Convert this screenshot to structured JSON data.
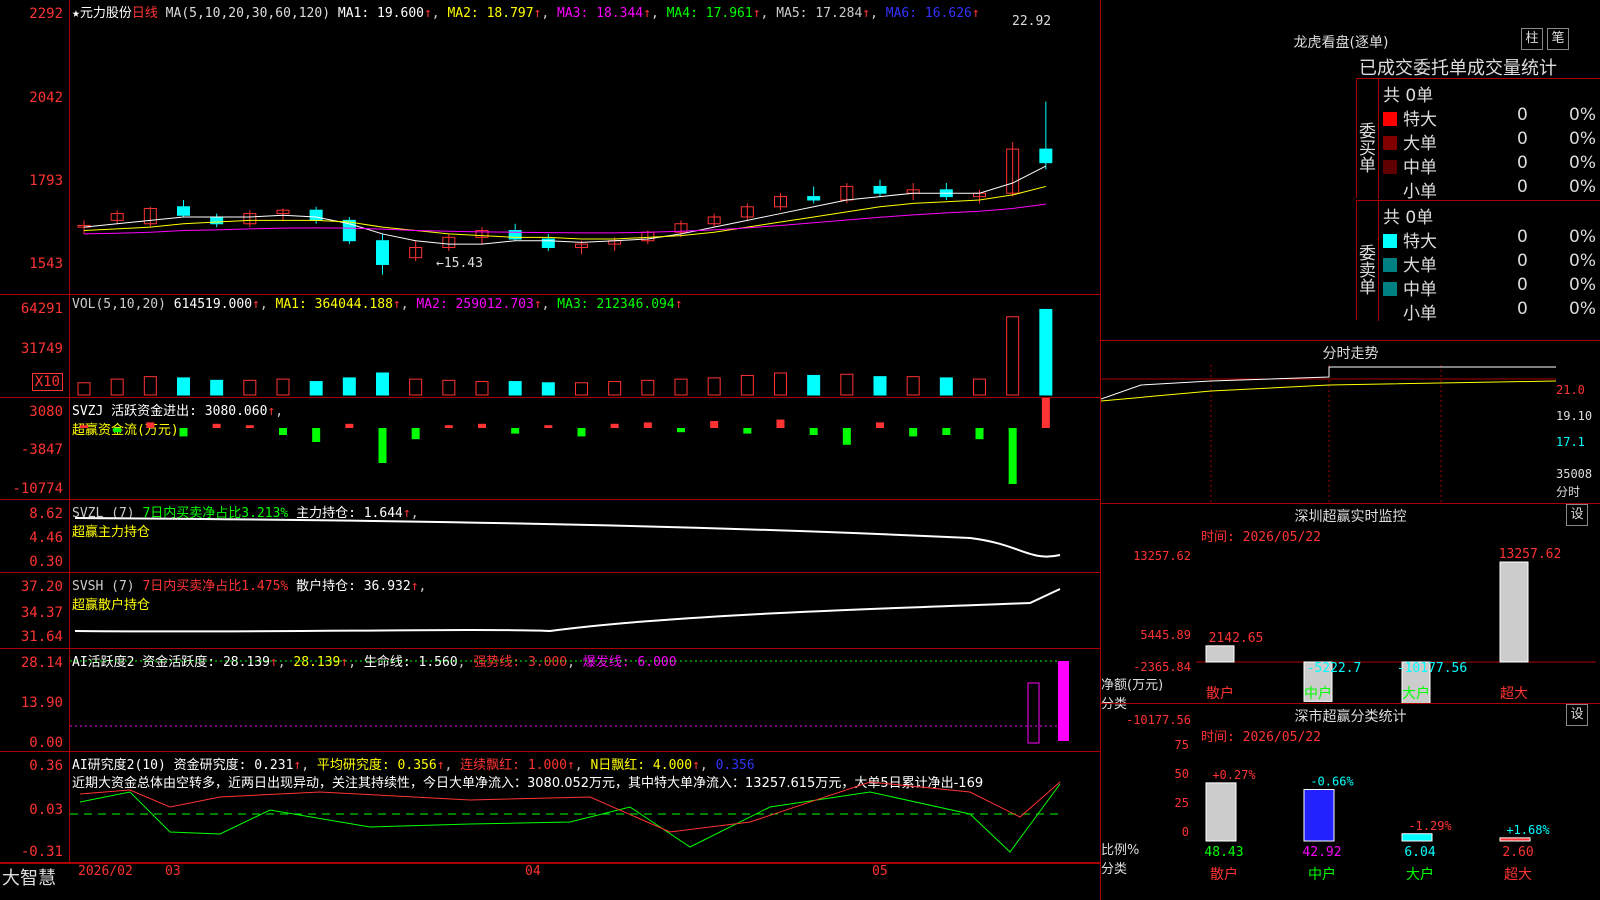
{
  "chart_data": {
    "type": "candlestick",
    "price_ticks": [
      "2292",
      "2042",
      "1793",
      "1543"
    ],
    "last_price": "22.92",
    "low_price": "15.43",
    "candles": [
      [
        16.8,
        17.0,
        16.6,
        16.85
      ],
      [
        17.0,
        17.3,
        16.9,
        17.2
      ],
      [
        16.9,
        17.4,
        16.8,
        17.35
      ],
      [
        17.4,
        17.6,
        17.1,
        17.15
      ],
      [
        17.1,
        17.2,
        16.8,
        16.9
      ],
      [
        16.9,
        17.3,
        16.8,
        17.2
      ],
      [
        17.2,
        17.35,
        17.0,
        17.3
      ],
      [
        17.3,
        17.4,
        16.9,
        17.0
      ],
      [
        17.0,
        17.1,
        16.3,
        16.4
      ],
      [
        16.4,
        16.6,
        15.4,
        15.7
      ],
      [
        15.9,
        16.4,
        15.8,
        16.2
      ],
      [
        16.2,
        16.6,
        16.1,
        16.5
      ],
      [
        16.5,
        16.8,
        16.3,
        16.7
      ],
      [
        16.7,
        16.9,
        16.4,
        16.45
      ],
      [
        16.45,
        16.6,
        16.1,
        16.2
      ],
      [
        16.2,
        16.4,
        16.0,
        16.3
      ],
      [
        16.3,
        16.5,
        16.1,
        16.4
      ],
      [
        16.4,
        16.7,
        16.3,
        16.65
      ],
      [
        16.65,
        17.0,
        16.5,
        16.9
      ],
      [
        16.9,
        17.2,
        16.8,
        17.1
      ],
      [
        17.1,
        17.5,
        17.0,
        17.4
      ],
      [
        17.4,
        17.8,
        17.3,
        17.7
      ],
      [
        17.7,
        18.0,
        17.5,
        17.6
      ],
      [
        17.6,
        18.1,
        17.5,
        18.0
      ],
      [
        18.0,
        18.2,
        17.7,
        17.8
      ],
      [
        17.8,
        18.1,
        17.6,
        17.9
      ],
      [
        17.9,
        18.1,
        17.6,
        17.7
      ],
      [
        17.7,
        17.9,
        17.5,
        17.8
      ],
      [
        17.8,
        19.3,
        17.7,
        19.1
      ],
      [
        19.1,
        20.5,
        18.5,
        18.7
      ]
    ],
    "ma": {
      "MA1": [
        16.8,
        16.9,
        17.0,
        17.1,
        17.1,
        17.1,
        17.15,
        17.1,
        16.9,
        16.6,
        16.4,
        16.3,
        16.3,
        16.4,
        16.4,
        16.35,
        16.4,
        16.45,
        16.6,
        16.8,
        17.0,
        17.2,
        17.4,
        17.6,
        17.7,
        17.8,
        17.8,
        17.8,
        18.1,
        18.6
      ],
      "MA2": [
        16.7,
        16.75,
        16.8,
        16.9,
        16.95,
        17.0,
        17.0,
        17.0,
        16.95,
        16.8,
        16.7,
        16.6,
        16.55,
        16.5,
        16.5,
        16.45,
        16.45,
        16.5,
        16.55,
        16.65,
        16.8,
        16.95,
        17.1,
        17.25,
        17.4,
        17.5,
        17.55,
        17.6,
        17.75,
        18.0
      ],
      "MA3": [
        16.6,
        16.62,
        16.65,
        16.7,
        16.72,
        16.75,
        16.77,
        16.78,
        16.77,
        16.74,
        16.7,
        16.68,
        16.66,
        16.65,
        16.64,
        16.63,
        16.63,
        16.65,
        16.68,
        16.72,
        16.78,
        16.85,
        16.93,
        17.01,
        17.09,
        17.16,
        17.22,
        17.27,
        17.35,
        17.48
      ]
    },
    "vol": [
      1.0,
      1.3,
      1.5,
      1.4,
      1.2,
      1.2,
      1.3,
      1.1,
      1.4,
      1.8,
      1.3,
      1.2,
      1.1,
      1.1,
      1.0,
      1.0,
      1.1,
      1.2,
      1.3,
      1.4,
      1.6,
      1.8,
      1.6,
      1.7,
      1.5,
      1.5,
      1.4,
      1.3,
      6.4,
      7.0
    ],
    "flow": [
      0.2,
      -0.3,
      0.4,
      -0.6,
      0.3,
      0.2,
      -0.5,
      -1.0,
      0.3,
      -2.5,
      -0.8,
      0.2,
      0.3,
      -0.4,
      0.2,
      -0.6,
      0.3,
      0.4,
      -0.3,
      0.5,
      -0.4,
      0.6,
      -0.5,
      -1.2,
      0.4,
      -0.6,
      -0.5,
      -0.8,
      -4.0,
      3.0
    ]
  },
  "legend": {
    "title": "★元力股份",
    "period": "日线",
    "ma": "MA(5,10,20,30,60,120)",
    "ma1": "MA1: 19.600",
    "ma2": "MA2: 18.797",
    "ma3": "MA3: 18.344",
    "ma4": "MA4: 17.961",
    "ma5": "MA5: 17.284",
    "ma6": "MA6: 16.626"
  },
  "vol": {
    "ticks": [
      "64291",
      "31749",
      "X10"
    ],
    "legend": "VOL(5,10,20)",
    "v": "614519.000",
    "ma1": "MA1: 364044.188",
    "ma2": "MA2: 259012.703",
    "ma3": "MA3: 212346.094"
  },
  "svzj": {
    "ticks": [
      "3080",
      "-3847",
      "-10774"
    ],
    "legend": "SVZJ  活跃资金进出: 3080.060",
    "sub": "超赢资金流(万元)"
  },
  "svzl": {
    "ticks": [
      "8.62",
      "4.46",
      "0.30"
    ],
    "legend": "SVZL (7)",
    "pct": "7日内买卖净占比3.213%",
    "main": "主力持仓: 1.644",
    "sub": "超赢主力持仓"
  },
  "svsh": {
    "ticks": [
      "37.20",
      "34.37",
      "31.64"
    ],
    "legend": "SVSH (7)",
    "pct": "7日内买卖净占比1.475%",
    "retail": "散户持仓: 36.932",
    "sub": "超赢散户持仓"
  },
  "ai1": {
    "ticks": [
      "28.14",
      "13.90",
      "0.00"
    ],
    "legend": "AI活跃度2 资金活跃度: 28.139",
    "v2": "28.139",
    "life": "生命线: 1.560",
    "strong": "强势线: 3.000",
    "burst": "爆发线: 6.000"
  },
  "ai2": {
    "ticks": [
      "0.36",
      "0.03",
      "-0.31"
    ],
    "legend": "AI研究度2(10) 资金研究度: 0.231",
    "avg": "平均研究度: 0.356",
    "red": "连续飘红: 1.000",
    "nred": "N日飘红: 4.000",
    "last": "0.356",
    "note": "近期大资金总体由空转多，近两日出现异动，关注其持续性，今日大单净流入：3080.052万元，其中特大单净流入：13257.615万元，大单5日累计净出-169"
  },
  "xaxis": {
    "app": "大智慧",
    "d1": "2026/02",
    "d2": "03",
    "d3": "04",
    "d4": "05"
  },
  "lh": {
    "title": "龙虎看盘(逐单)",
    "b1": "柱",
    "b2": "笔",
    "sub": "已成交委托单成交量统计",
    "buy": "委买单",
    "sell": "委卖单",
    "total": "共 0单",
    "rows": [
      "特大",
      "大单",
      "中单",
      "小单"
    ],
    "zero": "0",
    "pct": "0%",
    "colors_buy": [
      "#ff0000",
      "#800000",
      "#600000",
      "#000"
    ],
    "colors_sell": [
      "#00ffff",
      "#008080",
      "#008080",
      "#000"
    ]
  },
  "fs": {
    "title": "分时走势",
    "t1": "21.0",
    "t2": "19.10",
    "t3": "17.1",
    "t4": "35008",
    "t5": "分时"
  },
  "sz": {
    "title": "深圳超赢实时监控",
    "set": "设",
    "time": "时间: 2026/05/22",
    "ticks": [
      "13257.62",
      "5445.89",
      "0",
      "-2365.84",
      "-10177.56"
    ],
    "unit": "净额(万元)",
    "cat": "分类",
    "cats": [
      "散户",
      "中户",
      "大户",
      "超大"
    ],
    "vals": [
      "2142.65",
      "-5222.7",
      "-10177.56",
      "13257.62"
    ]
  },
  "sf": {
    "title": "深市超赢分类统计",
    "set": "设",
    "time": "时间: 2026/05/22",
    "ticks": [
      "75",
      "50",
      "25",
      "0"
    ],
    "pct": [
      "+0.27%",
      "-0.66%",
      "-1.29%",
      "+1.68%"
    ],
    "vals": [
      "48.43",
      "42.92",
      "6.04",
      "2.60"
    ],
    "lab": "比例%",
    "cat": "分类",
    "cats": [
      "散户",
      "中户",
      "大户",
      "超大"
    ]
  }
}
